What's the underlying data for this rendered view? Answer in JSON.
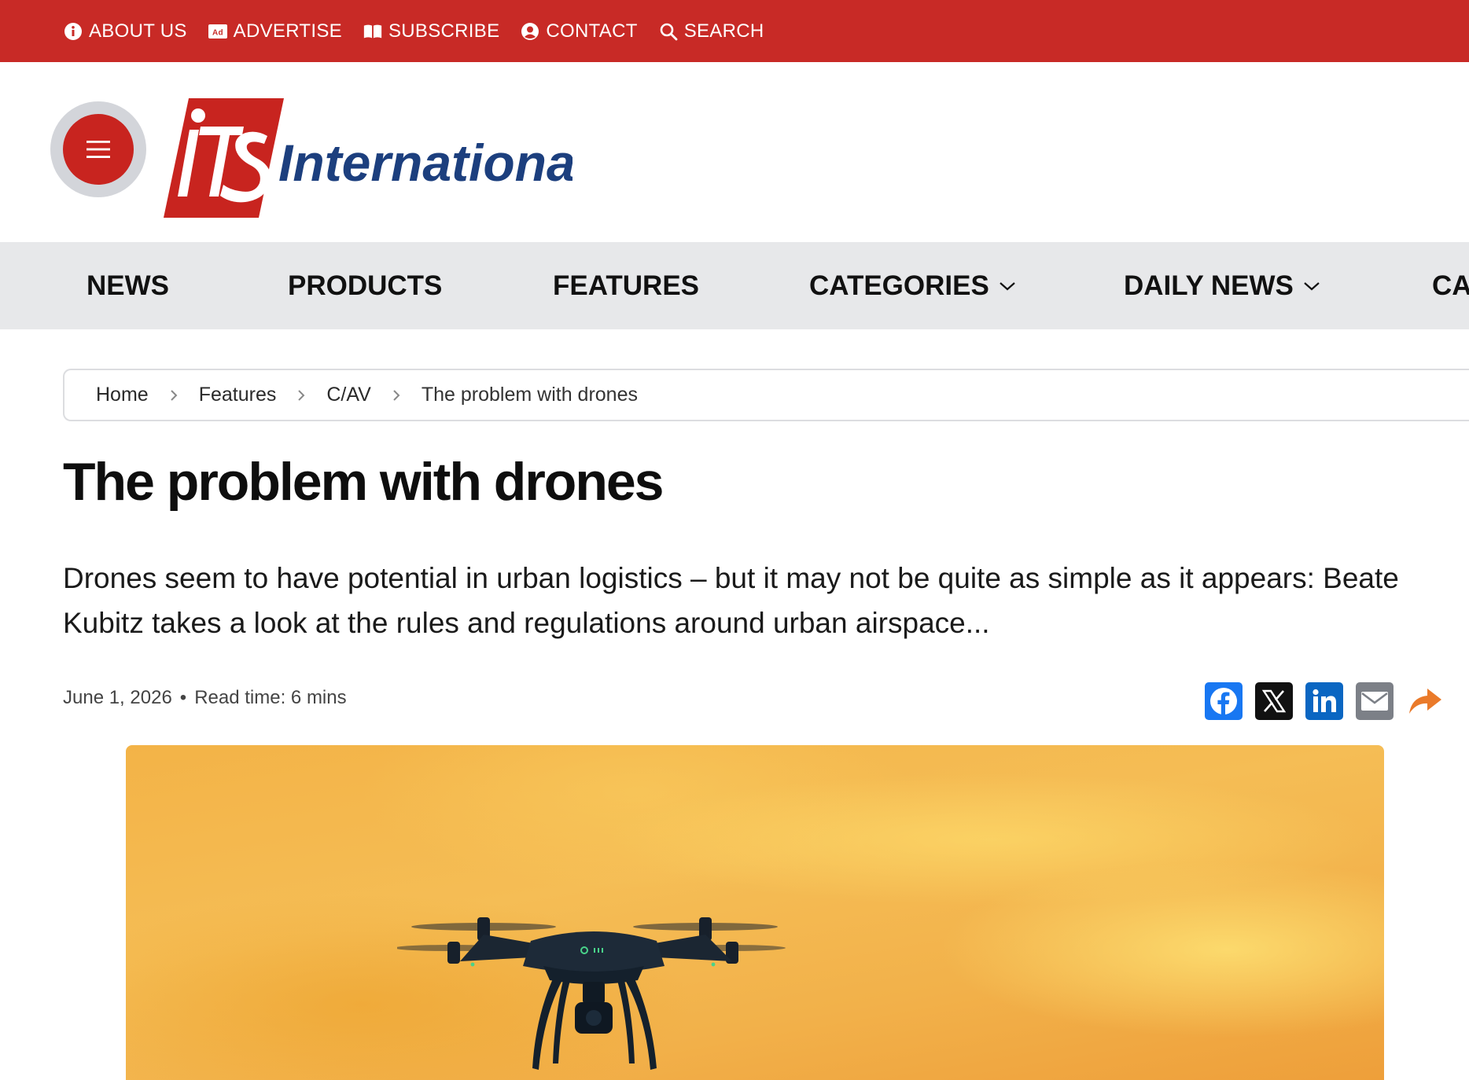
{
  "topbar": {
    "links": [
      {
        "label": "ABOUT US",
        "icon": "info-icon"
      },
      {
        "label": "ADVERTISE",
        "icon": "ad-icon"
      },
      {
        "label": "SUBSCRIBE",
        "icon": "book-icon"
      },
      {
        "label": "CONTACT",
        "icon": "user-icon"
      },
      {
        "label": "SEARCH",
        "icon": "search-icon"
      }
    ]
  },
  "header": {
    "logo_mark": "ITS",
    "logo_word": "International"
  },
  "nav": {
    "items": [
      {
        "label": "NEWS"
      },
      {
        "label": "PRODUCTS"
      },
      {
        "label": "FEATURES"
      },
      {
        "label": "CATEGORIES",
        "dropdown": true
      },
      {
        "label": "DAILY NEWS",
        "dropdown": true
      },
      {
        "label": "CA"
      }
    ]
  },
  "breadcrumb": {
    "items": [
      "Home",
      "Features",
      "C/AV",
      "The problem with drones"
    ]
  },
  "article": {
    "title": "The problem with drones",
    "lede": "Drones seem to have potential in urban logistics – but it may not be quite as simple as it appears: Beate Kubitz takes a look at the rules and regulations around urban airspace...",
    "date": "June 1, 2026",
    "dot": "•",
    "read_time": "Read time: 6 mins"
  },
  "share": {
    "buttons": [
      "facebook-icon",
      "x-icon",
      "linkedin-icon",
      "email-icon",
      "share-arrow-icon"
    ]
  },
  "colors": {
    "topbar": "#c82a26",
    "nav_bg": "#e7e8ea",
    "brand_blue": "#1c3f7e",
    "facebook": "#1877f2",
    "linkedin": "#0a66c2",
    "share_orange": "#ea7a2a"
  }
}
